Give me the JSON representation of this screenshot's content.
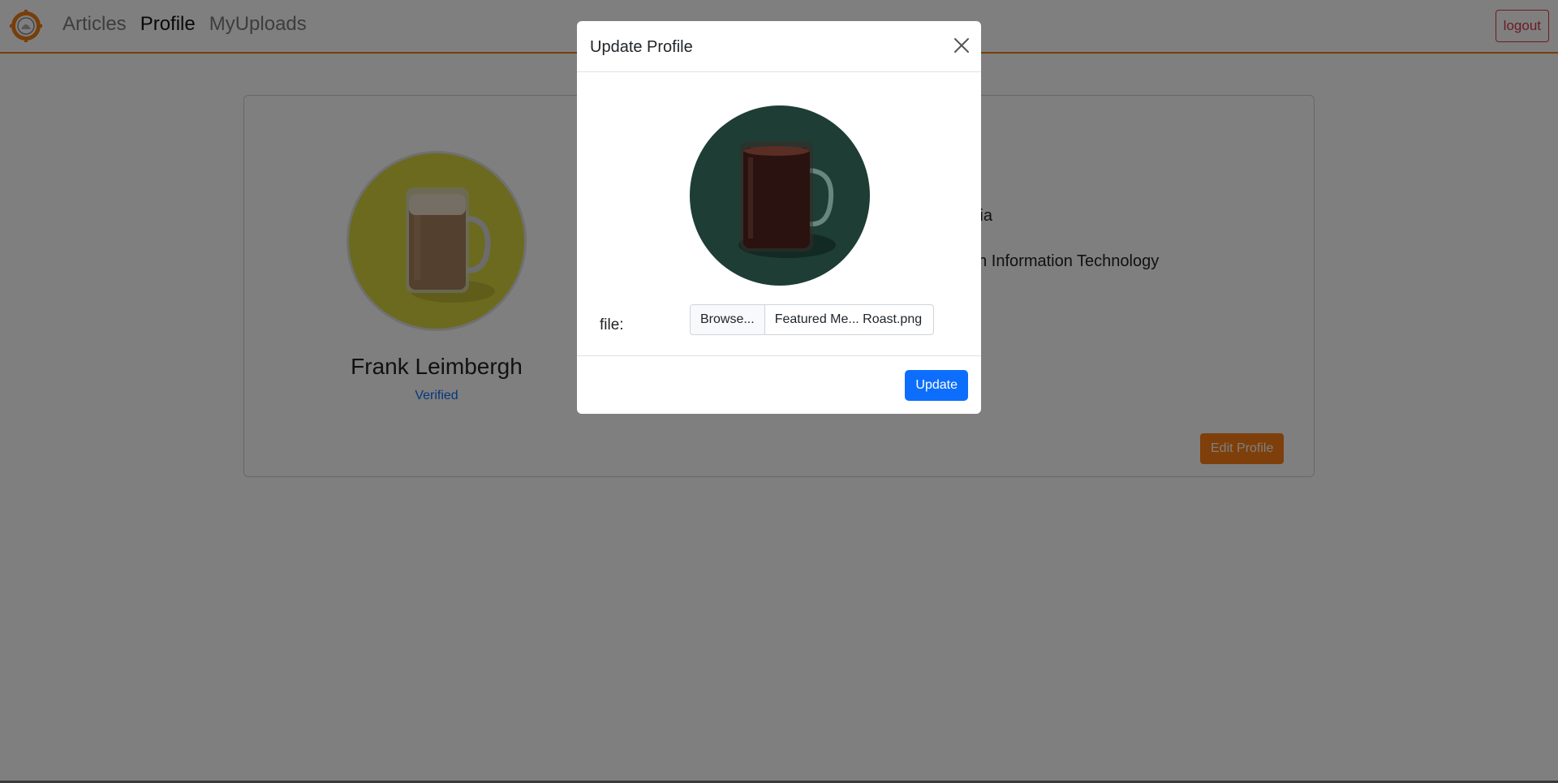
{
  "nav": {
    "items": [
      {
        "label": "Articles"
      },
      {
        "label": "Profile",
        "active": true
      },
      {
        "label": "MyUploads"
      }
    ],
    "logout_label": "logout"
  },
  "profile": {
    "name": "Frank Leimbergh",
    "status": "Verified",
    "field_1_partial": "nodia",
    "field_2_partial": "ce in Information Technology",
    "edit_label": "Edit Profile"
  },
  "modal": {
    "title": "Update Profile",
    "file_label": "file:",
    "browse_label": "Browse...",
    "file_name": "Featured Me... Roast.png",
    "submit_label": "Update"
  },
  "colors": {
    "accent": "#f07d14",
    "edit_button": "#fd7e14",
    "primary": "#0d6efd",
    "danger": "#dc3545",
    "avatar_bg": "#d6d43f",
    "preview_bg": "#1e3d35"
  },
  "icons": {
    "logo": "gear-seal-logo",
    "close": "close-icon"
  }
}
